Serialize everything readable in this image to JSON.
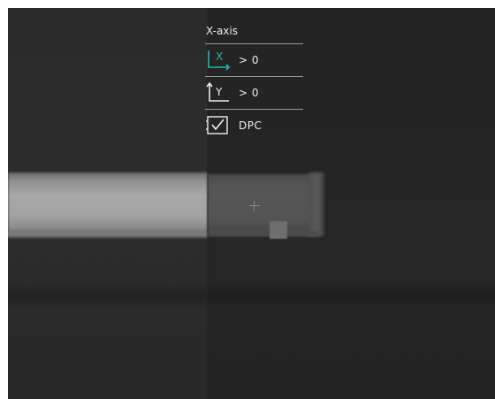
{
  "menu": {
    "title": "X-axis",
    "items": [
      {
        "icon": "x-axis-icon",
        "letter": "X",
        "value": "> 0",
        "accent": "#26b5a8"
      },
      {
        "icon": "y-axis-icon",
        "letter": "Y",
        "value": "> 0",
        "accent": "#ededed"
      },
      {
        "icon": "checkbox-icon",
        "value": "DPC",
        "accent": "#ededed"
      }
    ]
  },
  "colors": {
    "osd_text": "#ededed",
    "osd_accent": "#26b5a8",
    "separator": "#9a9a9a"
  }
}
